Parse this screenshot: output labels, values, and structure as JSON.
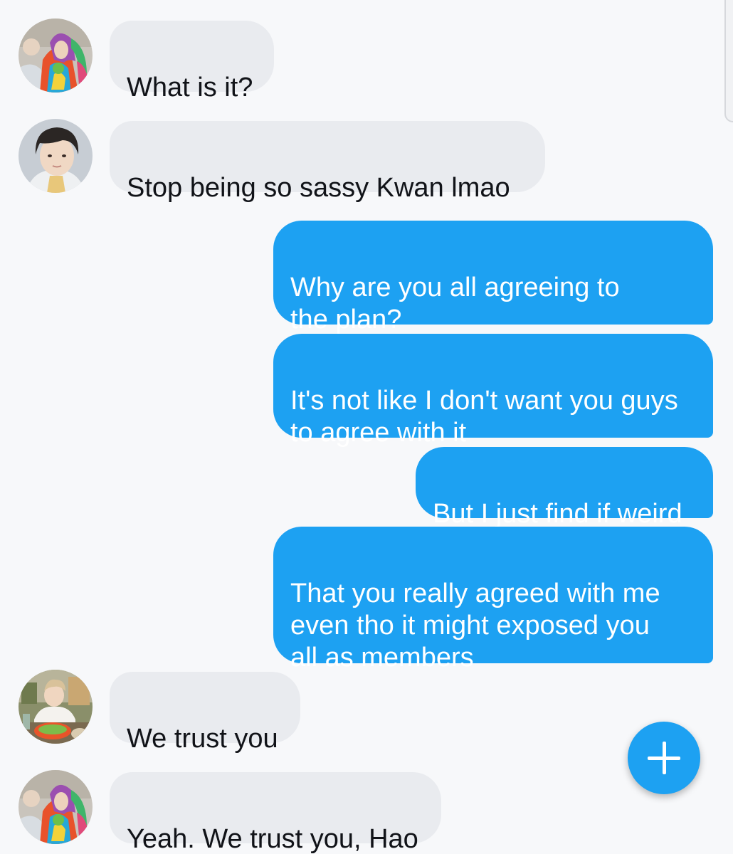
{
  "theme": {
    "background": "#f7f8fa",
    "incoming_bubble": "#e9ebef",
    "outgoing_bubble": "#1da1f2",
    "fab": "#1da1f2"
  },
  "messages": [
    {
      "direction": "incoming",
      "sender_avatar": "avatar-tie-dye-hoodie",
      "text": "What is it?"
    },
    {
      "direction": "incoming",
      "sender_avatar": "avatar-dark-hair",
      "text": "Stop being so sassy Kwan lmao"
    },
    {
      "direction": "outgoing",
      "text": "Why are you all agreeing to\nthe plan?"
    },
    {
      "direction": "outgoing",
      "text": "It's not like I don't want you guys\nto agree with it"
    },
    {
      "direction": "outgoing",
      "text": "But I just find if weird"
    },
    {
      "direction": "outgoing",
      "text": "That you really agreed with me\neven tho it might exposed you\nall as members"
    },
    {
      "direction": "incoming",
      "sender_avatar": "avatar-restaurant-table",
      "text": "We trust you"
    },
    {
      "direction": "incoming",
      "sender_avatar": "avatar-tie-dye-hoodie",
      "text": "Yeah. We trust you, Hao"
    }
  ],
  "fab": {
    "icon": "plus-icon"
  }
}
